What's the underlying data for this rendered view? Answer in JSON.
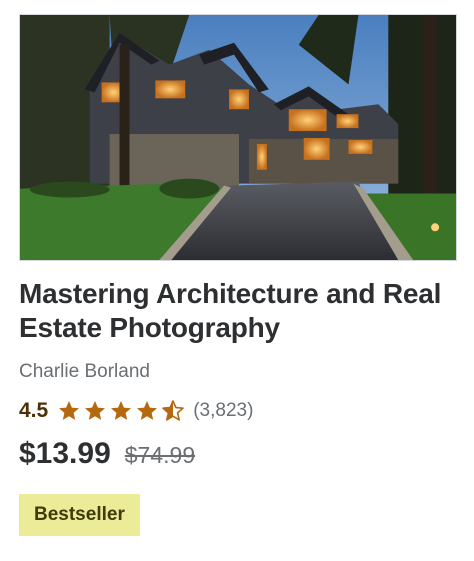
{
  "course": {
    "title": "Mastering Architecture and Real Estate Photography",
    "instructor": "Charlie Borland",
    "rating": "4.5",
    "rating_value": 4.5,
    "rating_count": "(3,823)",
    "price_current": "$13.99",
    "price_original": "$74.99",
    "badge": "Bestseller"
  },
  "colors": {
    "star": "#b4690e",
    "badge_bg": "#eceb98",
    "title": "#2d2f31",
    "muted": "#6a6f73"
  }
}
